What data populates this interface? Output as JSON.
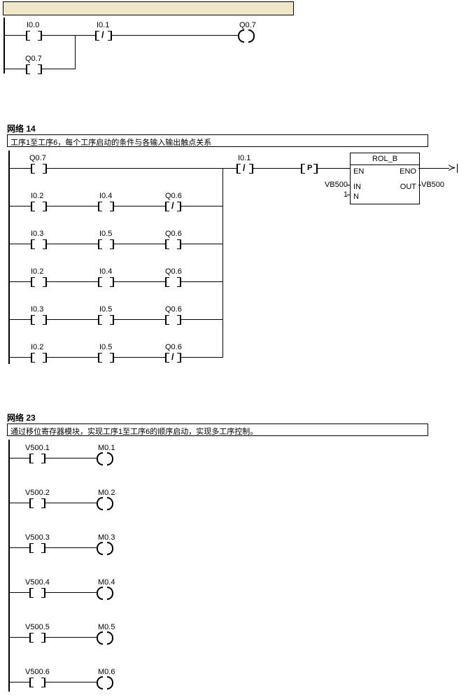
{
  "network1": {
    "rung1": {
      "c1": "I0.0",
      "c2": "I0.1",
      "coil": "Q0.7"
    },
    "rung2": {
      "c1": "Q0.7"
    }
  },
  "network14": {
    "title": "网络 14",
    "comment": "工序1至工序6，每个工序启动的条件与各输入输出触点关系",
    "rung1": {
      "c1": "Q0.7",
      "c3": "I0.1",
      "p": "P"
    },
    "instr": {
      "name": "ROL_B",
      "en": "EN",
      "eno": "ENO",
      "in_lbl": "IN",
      "out_lbl": "OUT",
      "n_lbl": "N",
      "in_val": "VB500",
      "out_val": "VB500",
      "n_val": "1"
    },
    "rungs": [
      {
        "c1": "I0.2",
        "c2": "I0.4",
        "c3": "Q0.6",
        "nc3": true
      },
      {
        "c1": "I0.3",
        "c2": "I0.5",
        "c3": "Q0.6",
        "nc3": false
      },
      {
        "c1": "I0.2",
        "c2": "I0.4",
        "c3": "Q0.6",
        "nc3": false
      },
      {
        "c1": "I0.3",
        "c2": "I0.5",
        "c3": "Q0.6",
        "nc3": false
      },
      {
        "c1": "I0.2",
        "c2": "I0.5",
        "c3": "Q0.6",
        "nc3": true
      }
    ]
  },
  "network23": {
    "title": "网络 23",
    "comment": "通过移位寄存器模块，实现工序1至工序6的顺序启动，实现多工序控制。",
    "rungs": [
      {
        "contact": "V500.1",
        "coil": "M0.1"
      },
      {
        "contact": "V500.2",
        "coil": "M0.2"
      },
      {
        "contact": "V500.3",
        "coil": "M0.3"
      },
      {
        "contact": "V500.4",
        "coil": "M0.4"
      },
      {
        "contact": "V500.5",
        "coil": "M0.5"
      },
      {
        "contact": "V500.6",
        "coil": "M0.6"
      }
    ]
  }
}
